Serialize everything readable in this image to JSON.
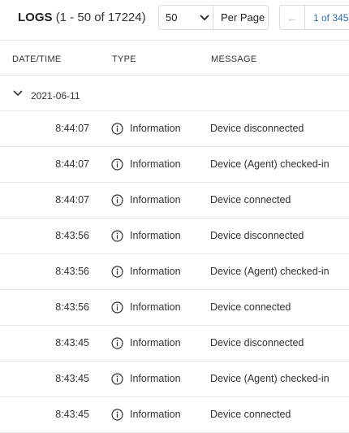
{
  "header": {
    "title": "LOGS",
    "range": "(1 - 50 of 17224)",
    "per_page_value": "50",
    "per_page_label": "Per Page",
    "page_indicator": "1 of 345"
  },
  "columns": {
    "datetime": "DATE/TIME",
    "type": "TYPE",
    "message": "MESSAGE"
  },
  "group": {
    "date": "2021-06-11"
  },
  "rows": [
    {
      "time": "8:44:07",
      "type": "Information",
      "message": "Device disconnected",
      "icon": "info-icon"
    },
    {
      "time": "8:44:07",
      "type": "Information",
      "message": "Device (Agent) checked-in",
      "icon": "info-icon"
    },
    {
      "time": "8:44:07",
      "type": "Information",
      "message": "Device connected",
      "icon": "info-icon"
    },
    {
      "time": "8:43:56",
      "type": "Information",
      "message": "Device disconnected",
      "icon": "info-icon"
    },
    {
      "time": "8:43:56",
      "type": "Information",
      "message": "Device (Agent) checked-in",
      "icon": "info-icon"
    },
    {
      "time": "8:43:56",
      "type": "Information",
      "message": "Device connected",
      "icon": "info-icon"
    },
    {
      "time": "8:43:45",
      "type": "Information",
      "message": "Device disconnected",
      "icon": "info-icon"
    },
    {
      "time": "8:43:45",
      "type": "Information",
      "message": "Device (Agent) checked-in",
      "icon": "info-icon"
    },
    {
      "time": "8:43:45",
      "type": "Information",
      "message": "Device connected",
      "icon": "info-icon"
    }
  ],
  "colors": {
    "link": "#2f6fb0",
    "border": "#e6e6e6"
  }
}
